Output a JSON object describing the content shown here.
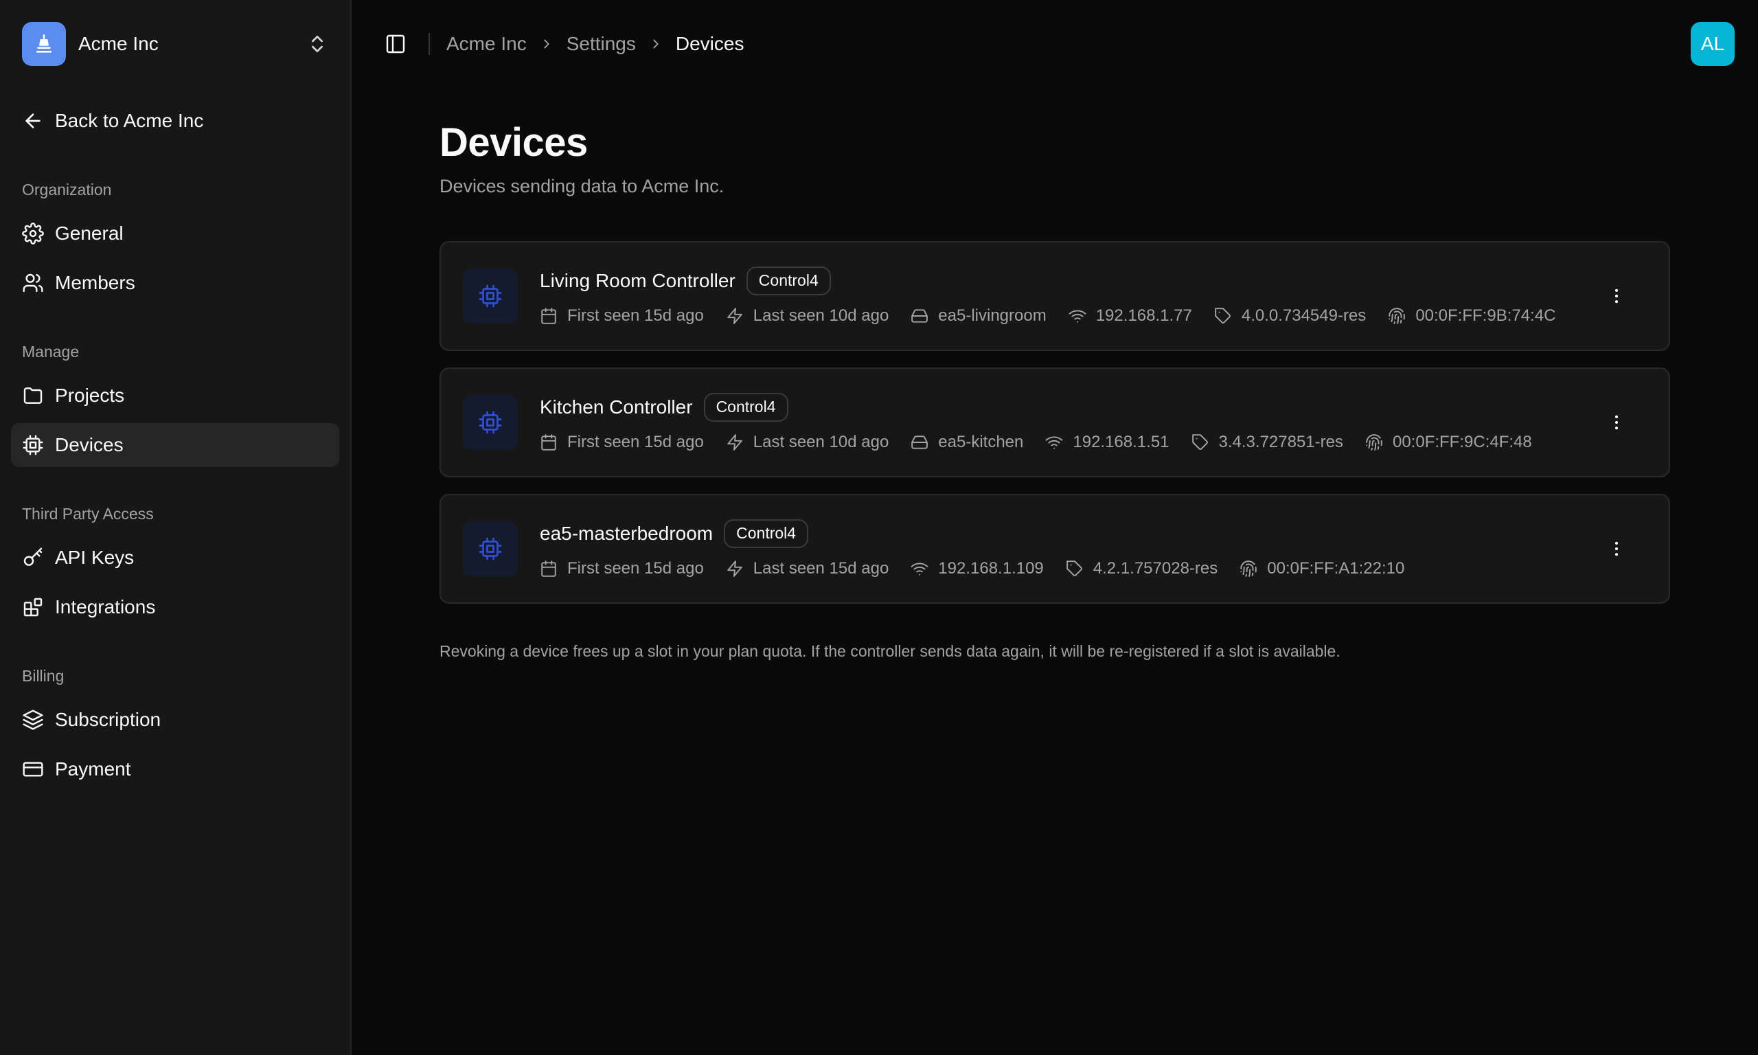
{
  "org": {
    "name": "Acme Inc"
  },
  "sidebar": {
    "back_label": "Back to Acme Inc",
    "sections": [
      {
        "title": "Organization",
        "items": [
          {
            "label": "General",
            "icon": "gear-icon"
          },
          {
            "label": "Members",
            "icon": "users-icon"
          }
        ]
      },
      {
        "title": "Manage",
        "items": [
          {
            "label": "Projects",
            "icon": "folder-icon"
          },
          {
            "label": "Devices",
            "icon": "cpu-icon",
            "active": true
          }
        ]
      },
      {
        "title": "Third Party Access",
        "items": [
          {
            "label": "API Keys",
            "icon": "key-icon"
          },
          {
            "label": "Integrations",
            "icon": "blocks-icon"
          }
        ]
      },
      {
        "title": "Billing",
        "items": [
          {
            "label": "Subscription",
            "icon": "layers-icon"
          },
          {
            "label": "Payment",
            "icon": "credit-card-icon"
          }
        ]
      }
    ]
  },
  "breadcrumb": [
    "Acme Inc",
    "Settings",
    "Devices"
  ],
  "user": {
    "initials": "AL"
  },
  "page": {
    "title": "Devices",
    "subtitle": "Devices sending data to Acme Inc.",
    "footnote": "Revoking a device frees up a slot in your plan quota. If the controller sends data again, it will be re-registered if a slot is available."
  },
  "devices": [
    {
      "name": "Living Room Controller",
      "badge": "Control4",
      "first_seen": "First seen 15d ago",
      "last_seen": "Last seen 10d ago",
      "hostname": "ea5-livingroom",
      "ip": "192.168.1.77",
      "version": "4.0.0.734549-res",
      "mac": "00:0F:FF:9B:74:4C"
    },
    {
      "name": "Kitchen Controller",
      "badge": "Control4",
      "first_seen": "First seen 15d ago",
      "last_seen": "Last seen 10d ago",
      "hostname": "ea5-kitchen",
      "ip": "192.168.1.51",
      "version": "3.4.3.727851-res",
      "mac": "00:0F:FF:9C:4F:48"
    },
    {
      "name": "ea5-masterbedroom",
      "badge": "Control4",
      "first_seen": "First seen 15d ago",
      "last_seen": "Last seen 15d ago",
      "hostname": "",
      "ip": "192.168.1.109",
      "version": "4.2.1.757028-res",
      "mac": "00:0F:FF:A1:22:10"
    }
  ],
  "colors": {
    "accent": "#5b8cf0",
    "avatar": "#06b6d4",
    "device_icon": "#2f4fd6"
  }
}
